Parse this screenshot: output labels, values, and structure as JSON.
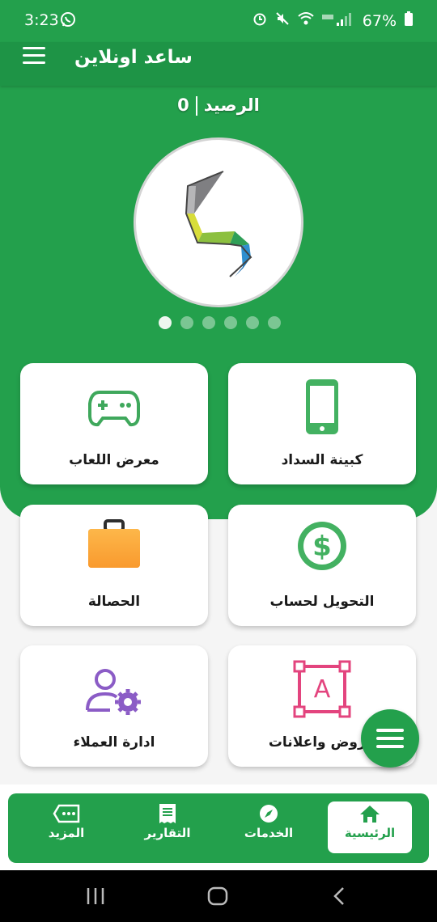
{
  "status_bar": {
    "time": "3:23",
    "battery": "67%"
  },
  "app_bar": {
    "title": "ساعد اونلاين"
  },
  "balance": {
    "label": "الرصيد",
    "value": "0"
  },
  "carousel": {
    "dot_count": 6,
    "active_index": 0
  },
  "cards": [
    {
      "label": "كبينة السداد",
      "icon": "phone-icon",
      "color": "#43b161"
    },
    {
      "label": "معرض اللعاب",
      "icon": "gamepad-icon",
      "color": "#3fa85c"
    },
    {
      "label": "التحويل لحساب",
      "icon": "dollar-coin-icon",
      "color": "#43b161"
    },
    {
      "label": "الحصالة",
      "icon": "briefcase-icon",
      "color": "#f9a23a"
    },
    {
      "label": "عروض واعلانات",
      "icon": "text-frame-icon",
      "color": "#e3447e"
    },
    {
      "label": "ادارة العملاء",
      "icon": "user-gear-icon",
      "color": "#8b5cc6"
    }
  ],
  "bottom_nav": [
    {
      "label": "الرئيسية",
      "icon": "home-icon",
      "active": true
    },
    {
      "label": "الخدمات",
      "icon": "compass-icon",
      "active": false
    },
    {
      "label": "التقارير",
      "icon": "receipt-icon",
      "active": false
    },
    {
      "label": "المزيد",
      "icon": "more-tag-icon",
      "active": false
    }
  ]
}
